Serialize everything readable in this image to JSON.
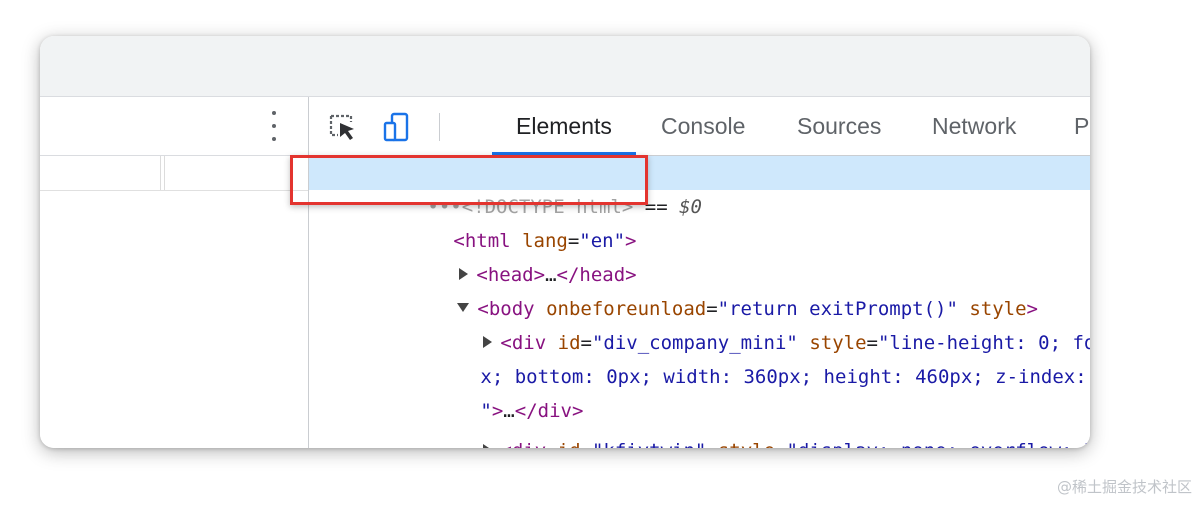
{
  "devtools": {
    "tabs": [
      {
        "label": "Elements",
        "active": true
      },
      {
        "label": "Console",
        "active": false
      },
      {
        "label": "Sources",
        "active": false
      },
      {
        "label": "Network",
        "active": false
      },
      {
        "label": "Perfo",
        "active": false
      }
    ],
    "toolbar": {
      "inspect_icon": "inspect-element-icon",
      "device_icon": "device-toolbar-icon",
      "menu_icon": "kebab-menu-icon"
    },
    "colors": {
      "accent": "#1a73e8",
      "selected_row": "#cfe8fc",
      "highlight_border": "#e3342f"
    }
  },
  "dom_tree": {
    "doctype": {
      "ellipsis": "•••",
      "text": "<!DOCTYPE html>",
      "eq": " == ",
      "ref": "$0"
    },
    "html_open": {
      "lt": "<",
      "tag": "html",
      "attr": "lang",
      "eq": "=",
      "value": "\"en\"",
      "gt": ">"
    },
    "head": {
      "lt": "<",
      "tag": "head",
      "gt": ">",
      "ellipsis": "…",
      "close": "</head>"
    },
    "body": {
      "lt": "<",
      "tag": "body",
      "attr1": "onbeforeunload",
      "eq": "=",
      "value1": "\"return exitPrompt()\"",
      "attr2": "style",
      "gt": ">"
    },
    "div1": {
      "lt": "<",
      "tag": "div",
      "attr1": "id",
      "eq": "=",
      "value1": "\"div_company_mini\"",
      "attr2": "style",
      "value2_part1": "\"line-height: 0; fo",
      "value2_part2": "x; bottom: 0px; width: 360px; height: 460px; z-index: ",
      "value2_part3": "\"",
      "gt": ">",
      "ellipsis": "…",
      "close": "</div>"
    },
    "div2": {
      "lt": "<",
      "tag": "div",
      "attr1": "id",
      "eq": "=",
      "value1": "\"kfivtwin\"",
      "attr2": "style",
      "value2": "\"display: none; overflow: h"
    }
  },
  "watermark": "@稀土掘金技术社区"
}
